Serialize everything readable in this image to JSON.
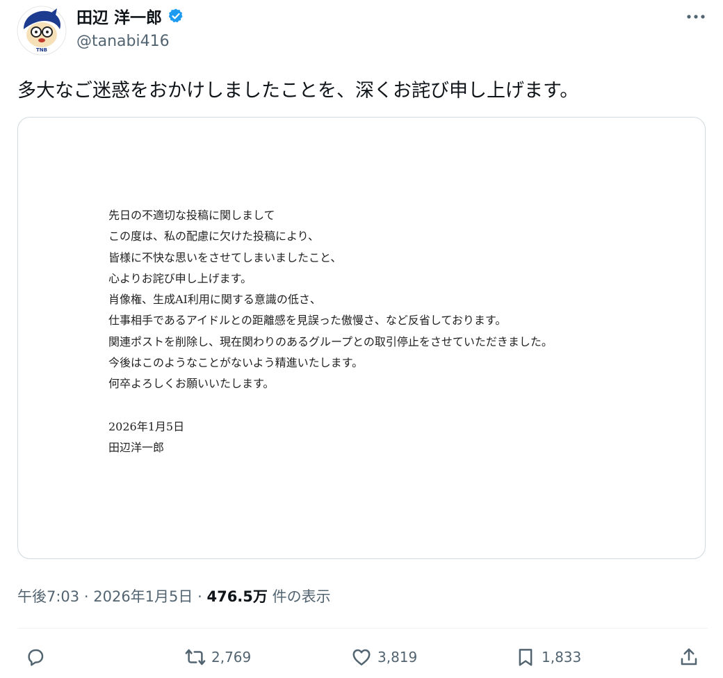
{
  "author": {
    "display_name": "田辺 洋一郎",
    "handle": "@tanabi416",
    "avatar_badge": "TNB"
  },
  "post": {
    "text": "多大なご迷惑をおかけしましたことを、深くお詫び申し上げます。",
    "letter": {
      "lines": [
        "先日の不適切な投稿に関しまして",
        "この度は、私の配慮に欠けた投稿により、",
        "皆様に不快な思いをさせてしまいましたこと、",
        "心よりお詫び申し上げます。",
        "肖像権、生成AI利用に関する意識の低さ、",
        "仕事相手であるアイドルとの距離感を見誤った傲慢さ、など反省しております。",
        "関連ポストを削除し、現在関わりのあるグループとの取引停止をさせていただきました。",
        "今後はこのようなことがないよう精進いたします。",
        "何卒よろしくお願いいたします。"
      ],
      "date": "2026年1月5日",
      "signature": "田辺洋一郎"
    },
    "time": "午後7:03",
    "date": "2026年1月5日",
    "separator": "·",
    "views_count": "476.5万",
    "views_label": "件の表示"
  },
  "actions": {
    "reply": {
      "icon": "reply-icon",
      "count": ""
    },
    "repost": {
      "icon": "repost-icon",
      "count": "2,769"
    },
    "like": {
      "icon": "heart-icon",
      "count": "3,819"
    },
    "bookmark": {
      "icon": "bookmark-icon",
      "count": "1,833"
    },
    "share": {
      "icon": "share-icon",
      "count": ""
    }
  },
  "colors": {
    "verified": "#1d9bf0",
    "text_primary": "#0f1419",
    "text_secondary": "#536471",
    "border": "#cfd9de"
  }
}
